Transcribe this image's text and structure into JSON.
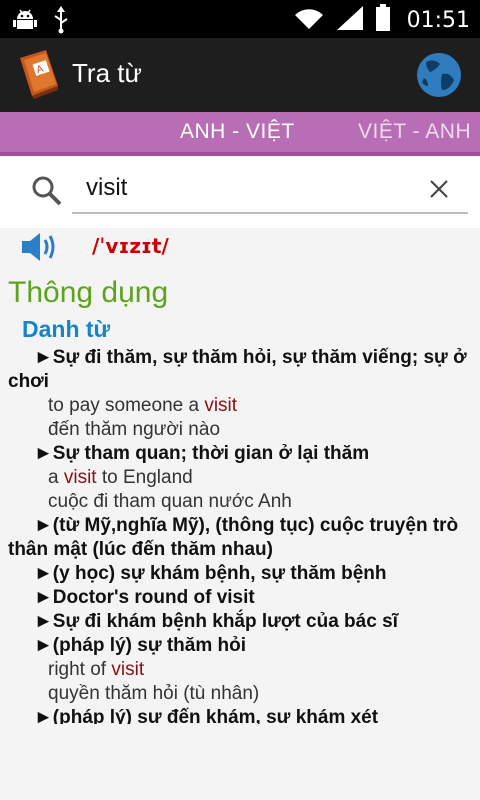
{
  "status_bar": {
    "time": "01:51"
  },
  "action_bar": {
    "title": "Tra từ"
  },
  "tabs": {
    "active": "ANH - VIỆT",
    "next": "VIỆT - ANH"
  },
  "search": {
    "value": "visit",
    "placeholder": ""
  },
  "entry": {
    "phonetic": "/ˈvɪzɪt/",
    "section": "Thông dụng",
    "part_of_speech": "Danh từ",
    "l1": "►Sự đi thăm, sự thăm hỏi, sự thăm viếng; sự ở",
    "l2": "chơi",
    "l3a": "to pay someone a ",
    "l3b": "visit",
    "l4": "đến thăm người nào",
    "l5": "►Sự tham quan; thời gian ở lại thăm",
    "l6a": "a ",
    "l6b": "visit",
    "l6c": " to England",
    "l7": "cuộc đi tham quan nước Anh",
    "l8": "►(từ Mỹ,nghĩa Mỹ), (thông tục) cuộc truyện trò",
    "l9": "thân mật (lúc đến thăm nhau)",
    "l10": "►(y học) sự khám bệnh, sự thăm bệnh",
    "l11": "►Doctor's round of visit",
    "l12": "►Sự đi khám bệnh khắp lượt của bác sĩ",
    "l13": "►(pháp lý) sự thăm hỏi",
    "l14a": "right of ",
    "l14b": "visit",
    "l15": "quyền thăm hỏi (tù nhân)",
    "l16": "►(pháp lý) sự đến khám, sự khám xét"
  }
}
